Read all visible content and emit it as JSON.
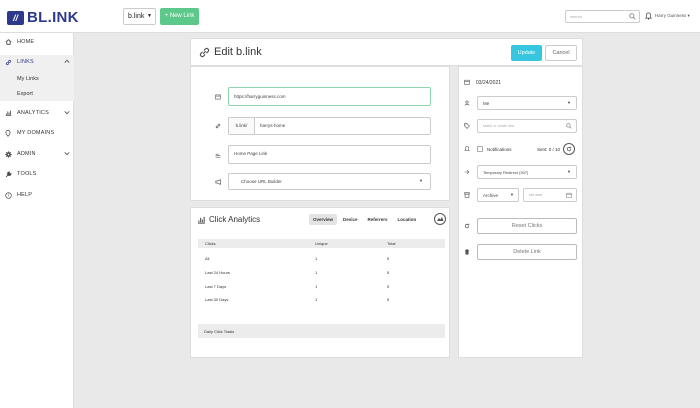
{
  "brand": {
    "logo_mark": "//",
    "logo_text": "BL.INK"
  },
  "topbar": {
    "domain": "b.link",
    "new_link": "+ New Link",
    "search_placeholder": "search",
    "user": "Harry Guinness"
  },
  "sidebar": {
    "home": "HOME",
    "links": "LINKS",
    "my_links": "My Links",
    "export": "Export",
    "analytics": "ANALYTICS",
    "my_domains": "MY DOMAINS",
    "admin": "ADMIN",
    "tools": "TOOLS",
    "help": "HELP"
  },
  "edit": {
    "title": "Edit b.link",
    "update": "Update",
    "cancel": "Cancel",
    "destination_url": "https://harryguinness.com",
    "domain_prefix": "b.link/",
    "slug": "harrys-home",
    "title_value": "Home Page Link",
    "url_builder": "Choose URL Builder"
  },
  "analytics": {
    "title": "Click Analytics",
    "tabs": [
      "Overview",
      "Device",
      "Referrers",
      "Location"
    ],
    "columns": [
      "Clicks",
      "Unique",
      "Total"
    ],
    "rows": [
      {
        "label": "All",
        "unique": "1",
        "total": "5"
      },
      {
        "label": "Last 24 Hours",
        "unique": "1",
        "total": "5"
      },
      {
        "label": "Last 7 Days",
        "unique": "1",
        "total": "5"
      },
      {
        "label": "Last 30 Days",
        "unique": "1",
        "total": "5"
      }
    ],
    "daily_totals": "Daily Click Totals"
  },
  "side": {
    "date": "03/24/2021",
    "owner": "Me",
    "tags_placeholder": "select or create new",
    "notifications": "Notifications",
    "sent": "Sent: 0 / 10",
    "redirect": "Temporary Redirect (307)",
    "archive": "Archive",
    "set_date": "set date",
    "reset_clicks": "Reset Clicks",
    "delete_link": "Delete Link"
  },
  "colors": {
    "brand": "#2d3a8c",
    "new_link": "#5cc98a",
    "update": "#37c6df"
  }
}
